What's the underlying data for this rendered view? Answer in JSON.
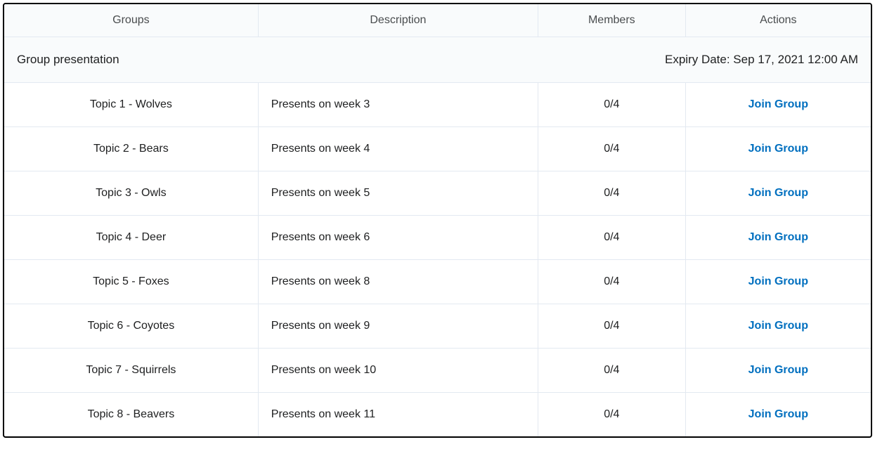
{
  "headers": {
    "groups": "Groups",
    "description": "Description",
    "members": "Members",
    "actions": "Actions"
  },
  "section": {
    "title": "Group presentation",
    "expiry_label": "Expiry Date: Sep 17, 2021 12:00 AM"
  },
  "action_label": "Join Group",
  "rows": [
    {
      "group": "Topic 1 - Wolves",
      "description": "Presents on week 3",
      "members": "0/4"
    },
    {
      "group": "Topic 2 - Bears",
      "description": "Presents on week 4",
      "members": "0/4"
    },
    {
      "group": "Topic 3 - Owls",
      "description": "Presents on week 5",
      "members": "0/4"
    },
    {
      "group": "Topic 4 - Deer",
      "description": "Presents on week 6",
      "members": "0/4"
    },
    {
      "group": "Topic 5 - Foxes",
      "description": "Presents on week 8",
      "members": "0/4"
    },
    {
      "group": "Topic 6 - Coyotes",
      "description": "Presents on week 9",
      "members": "0/4"
    },
    {
      "group": "Topic 7 - Squirrels",
      "description": "Presents on week 10",
      "members": "0/4"
    },
    {
      "group": "Topic 8 - Beavers",
      "description": "Presents on week 11",
      "members": "0/4"
    }
  ]
}
